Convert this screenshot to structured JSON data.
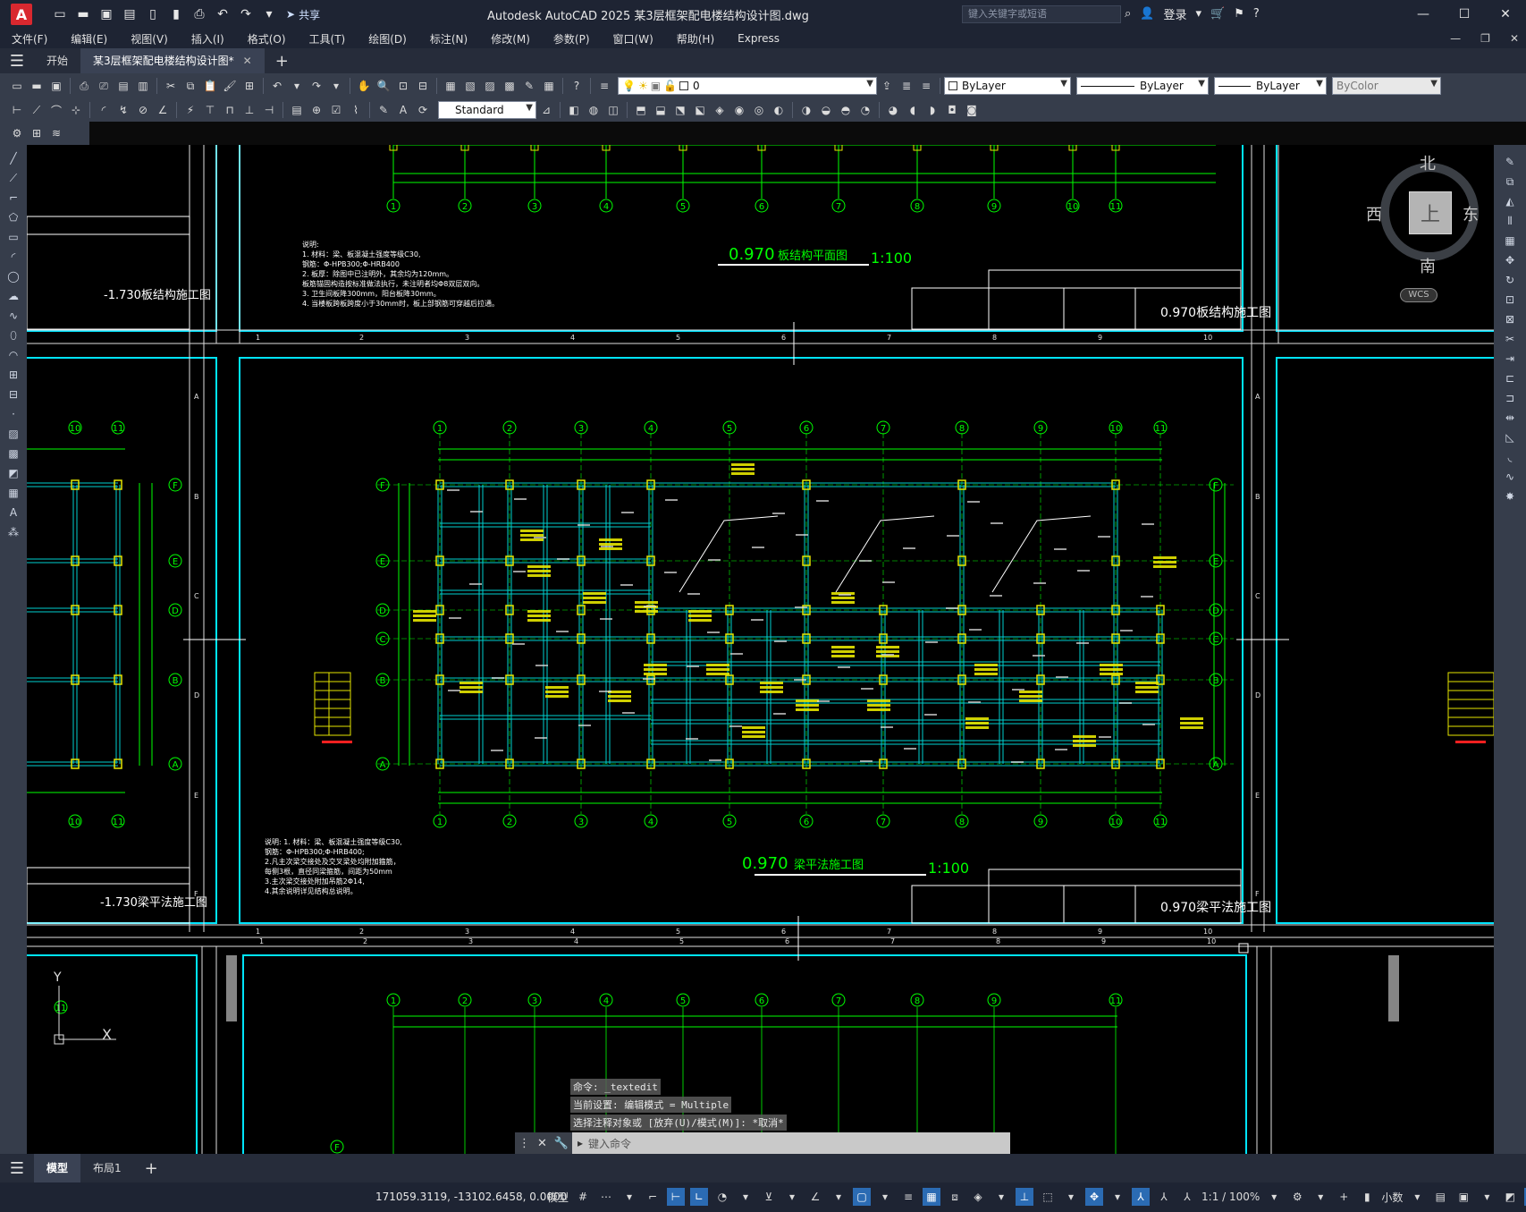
{
  "app": {
    "logo_letter": "A",
    "share_label": "共享",
    "window_title": "Autodesk AutoCAD 2025    某3层框架配电楼结构设计图.dwg",
    "search_placeholder": "键入关键字或短语",
    "login_label": "登录"
  },
  "menu": [
    "文件(F)",
    "编辑(E)",
    "视图(V)",
    "插入(I)",
    "格式(O)",
    "工具(T)",
    "绘图(D)",
    "标注(N)",
    "修改(M)",
    "参数(P)",
    "窗口(W)",
    "帮助(H)",
    "Express"
  ],
  "tabs": {
    "start": "开始",
    "doc": "某3层框架配电楼结构设计图*"
  },
  "toolbar": {
    "layer": "0",
    "color": "ByLayer",
    "linetype": "ByLayer",
    "lineweight": "ByLayer",
    "plotstyle": "ByColor",
    "textstyle": "Standard"
  },
  "viewcube": {
    "north": "北",
    "south": "南",
    "east": "东",
    "west": "西",
    "top": "上",
    "wcs": "WCS"
  },
  "drawing": {
    "title_top": "0.970",
    "title_top_name": "板结构平面图",
    "scale_top": "1:100",
    "title_main": "0.970",
    "title_main_name": "梁平法施工图",
    "scale_main": "1:100",
    "titleblock_top": "0.970板结构施工图",
    "titleblock_main": "0.970梁平法施工图",
    "left_top_block": "-1.730板结构施工图",
    "left_main_block": "-1.730梁平法施工图",
    "notes_top": [
      "说明:",
      "1. 材料：梁、板混凝土强度等级C30,",
      "   钢筋：Φ-HPB300;Φ-HRB400",
      "2. 板厚：除图中已注明外，其余均为120mm。",
      "   板筋锚固构造按标准做法执行，未注明者均Φ8双层双向。",
      "3. 卫生间板降300mm，阳台板降30mm。",
      "4. 当楼板跨板跨度小于30mm时，板上部钢筋可穿越后拉通。"
    ],
    "notes_main": [
      "说明: 1. 材料：梁、板混凝土强度等级C30,",
      "   钢筋：Φ-HPB300;Φ-HRB400;",
      "2.凡主次梁交接处及交叉梁处均附加箍筋，",
      "   每侧3根，直径同梁箍筋，间距为50mm",
      "3.主次梁交接处附加吊筋2Φ14,",
      "4.其余说明详见结构总说明。"
    ],
    "axis_top": [
      "1",
      "2",
      "3",
      "4",
      "5",
      "6",
      "7",
      "8",
      "9",
      "10",
      "11"
    ],
    "axis_left": [
      "F",
      "E",
      "D",
      "C",
      "B",
      "A"
    ],
    "frame_numbers": [
      "1",
      "2",
      "3",
      "4",
      "5",
      "6",
      "7",
      "8",
      "9",
      "10"
    ],
    "frame_letters": [
      "A",
      "B",
      "C",
      "D",
      "E",
      "F"
    ],
    "ucs_y": "Y",
    "ucs_x": "X"
  },
  "command": {
    "history": [
      "命令:  _textedit",
      "当前设置: 编辑模式 = Multiple",
      "选择注释对象或 [放弃(U)/模式(M)]: *取消*"
    ],
    "placeholder": "键入命令"
  },
  "layout_tabs": [
    "模型",
    "布局1"
  ],
  "status": {
    "coords": "171059.3119, -13102.6458, 0.0000",
    "model": "模型",
    "scale": "1:1 / 100%",
    "units": "小数"
  }
}
